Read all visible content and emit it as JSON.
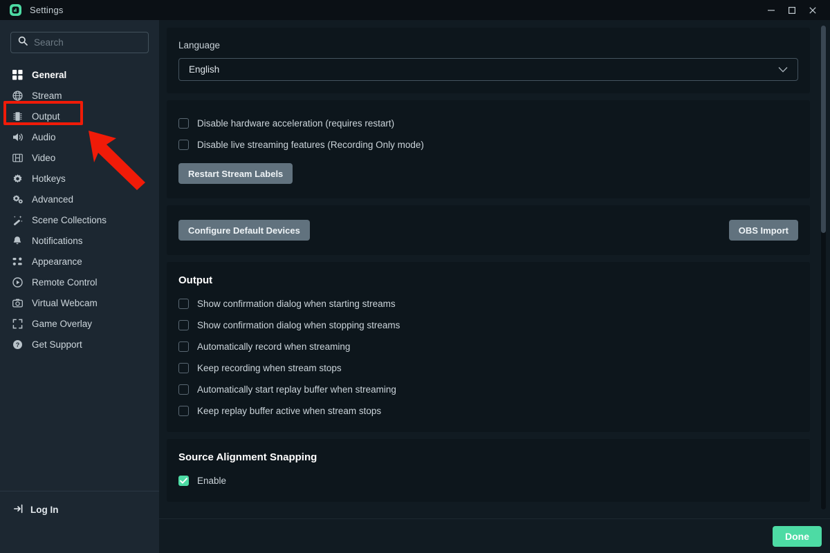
{
  "window": {
    "title": "Settings",
    "logo_icon": "streamlabs-logo-icon",
    "minimize_icon": "minimize-icon",
    "maximize_icon": "maximize-icon",
    "close_icon": "close-icon",
    "accent_color": "#4ddba4"
  },
  "sidebar": {
    "search": {
      "value": "",
      "placeholder": "Search",
      "icon": "search-icon"
    },
    "items": [
      {
        "label": "General",
        "icon": "grid-icon",
        "active": true
      },
      {
        "label": "Stream",
        "icon": "globe-icon",
        "active": false
      },
      {
        "label": "Output",
        "icon": "chip-icon",
        "active": false
      },
      {
        "label": "Audio",
        "icon": "speaker-icon",
        "active": false
      },
      {
        "label": "Video",
        "icon": "film-icon",
        "active": false
      },
      {
        "label": "Hotkeys",
        "icon": "gear-icon",
        "active": false
      },
      {
        "label": "Advanced",
        "icon": "gears-icon",
        "active": false
      },
      {
        "label": "Scene Collections",
        "icon": "wand-icon",
        "active": false
      },
      {
        "label": "Notifications",
        "icon": "bell-icon",
        "active": false
      },
      {
        "label": "Appearance",
        "icon": "dots-grid-icon",
        "active": false
      },
      {
        "label": "Remote Control",
        "icon": "play-circle-icon",
        "active": false
      },
      {
        "label": "Virtual Webcam",
        "icon": "camera-icon",
        "active": false
      },
      {
        "label": "Game Overlay",
        "icon": "expand-icon",
        "active": false
      },
      {
        "label": "Get Support",
        "icon": "help-circle-icon",
        "active": false
      }
    ],
    "login": {
      "label": "Log In",
      "icon": "login-icon"
    }
  },
  "main": {
    "language": {
      "label": "Language",
      "value": "English",
      "chevron_icon": "chevron-down-icon"
    },
    "general_toggles": [
      {
        "label": "Disable hardware acceleration (requires restart)",
        "checked": false
      },
      {
        "label": "Disable live streaming features (Recording Only mode)",
        "checked": false
      }
    ],
    "restart_stream_labels_button": "Restart Stream Labels",
    "configure_default_devices_button": "Configure Default Devices",
    "obs_import_button": "OBS Import",
    "output": {
      "title": "Output",
      "toggles": [
        {
          "label": "Show confirmation dialog when starting streams",
          "checked": false
        },
        {
          "label": "Show confirmation dialog when stopping streams",
          "checked": false
        },
        {
          "label": "Automatically record when streaming",
          "checked": false
        },
        {
          "label": "Keep recording when stream stops",
          "checked": false
        },
        {
          "label": "Automatically start replay buffer when streaming",
          "checked": false
        },
        {
          "label": "Keep replay buffer active when stream stops",
          "checked": false
        }
      ]
    },
    "source_alignment": {
      "title": "Source Alignment Snapping",
      "toggles": [
        {
          "label": "Enable",
          "checked": true
        }
      ]
    },
    "done_button": "Done"
  },
  "annotations": {
    "highlight_color": "#f01b08",
    "highlight_target": "Stream",
    "arrow": "pointer-arrow"
  }
}
